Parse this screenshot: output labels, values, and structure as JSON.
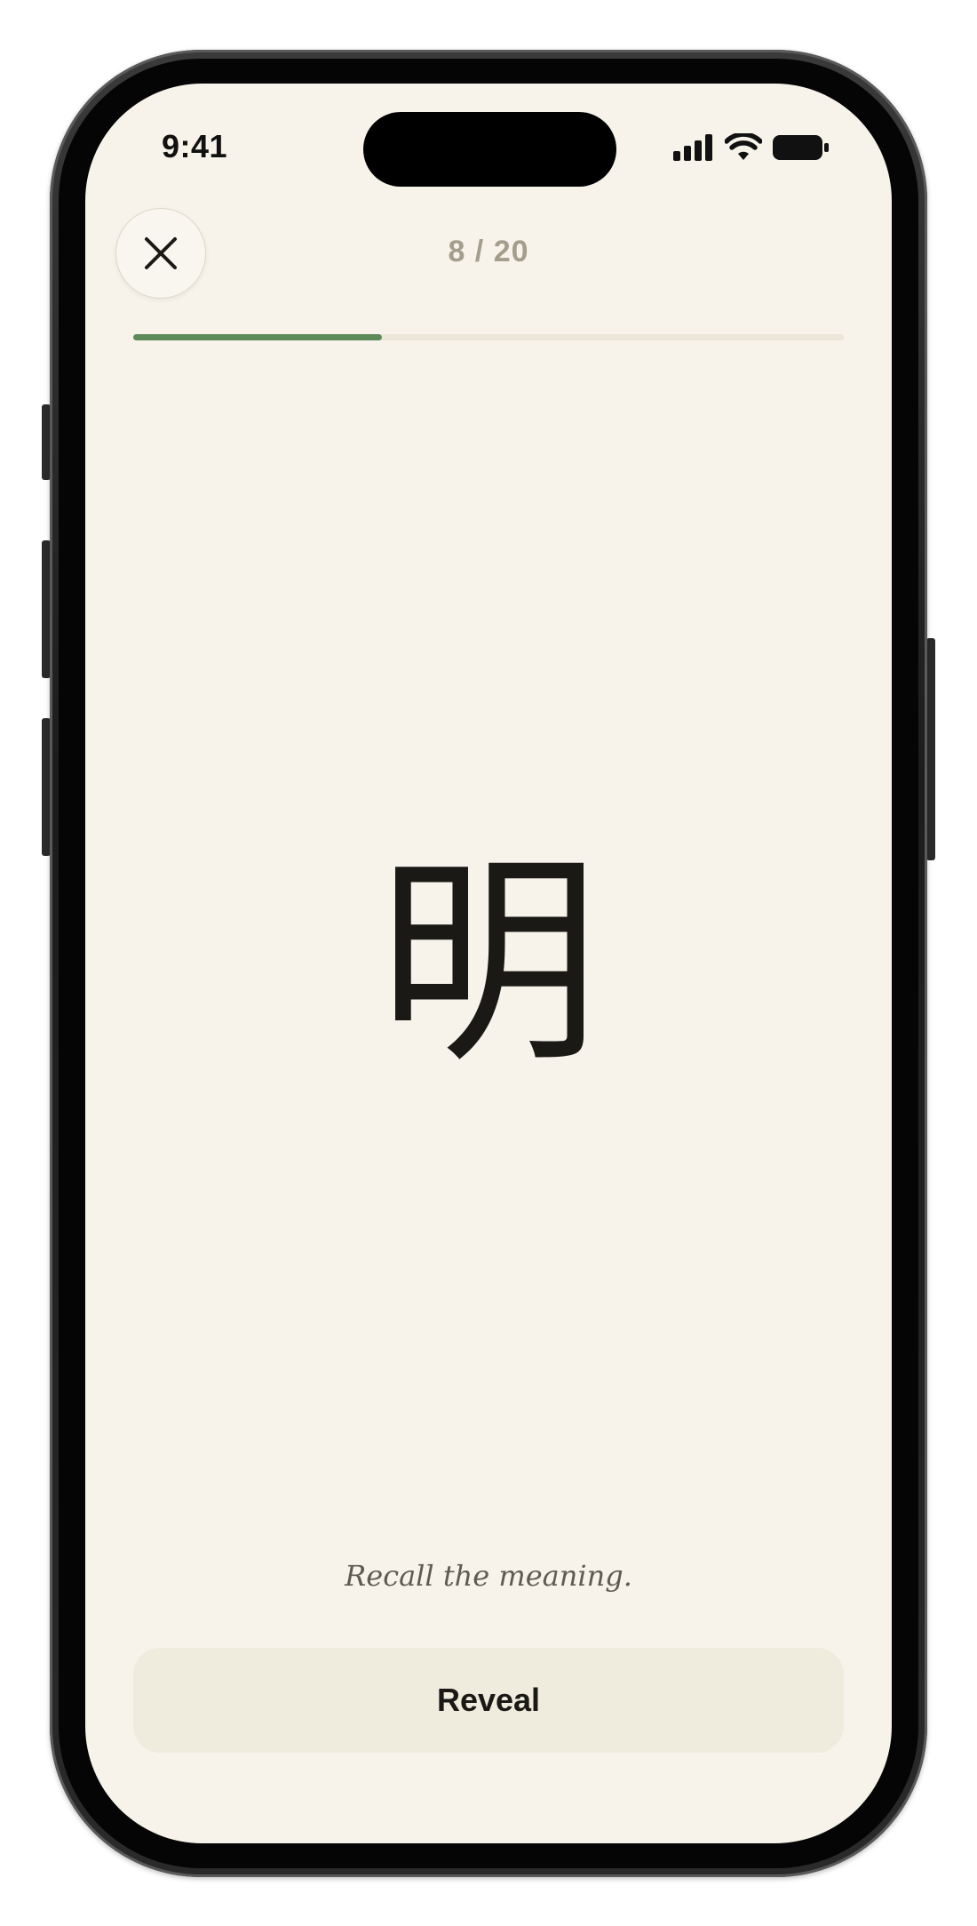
{
  "status_bar": {
    "time": "9:41",
    "icons": [
      "cellular-signal-icon",
      "wifi-icon",
      "battery-icon"
    ]
  },
  "header": {
    "close_icon": "close-icon",
    "counter": "8 / 20",
    "progress_fraction": 0.35
  },
  "card": {
    "character": "明",
    "prompt": "Recall the meaning."
  },
  "actions": {
    "reveal_label": "Reveal"
  },
  "colors": {
    "background": "#f7f3ea",
    "accent": "#5c8a59",
    "button": "#efebdd",
    "text": "#1a1915"
  }
}
